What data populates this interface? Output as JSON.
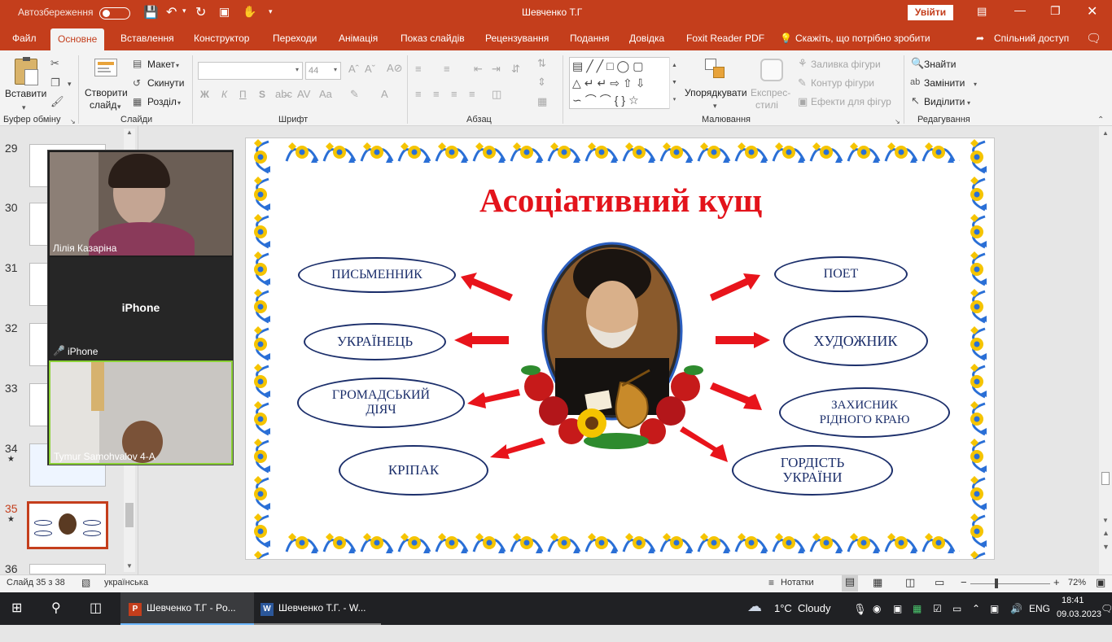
{
  "titlebar": {
    "autosave_label": "Автозбереження",
    "doc_title": "Шевченко Т.Г",
    "signin_button": "Увійти"
  },
  "tabs": [
    "Файл",
    "Основне",
    "Вставлення",
    "Конструктор",
    "Переходи",
    "Анімація",
    "Показ слайдів",
    "Рецензування",
    "Подання",
    "Довідка",
    "Foxit Reader PDF"
  ],
  "active_tab": "Основне",
  "tell_me": "Скажіть, що потрібно зробити",
  "share": "Спільний доступ",
  "ribbon": {
    "paste": "Вставити",
    "new_slide_line1": "Створити",
    "new_slide_line2": "слайд",
    "layout": "Макет",
    "reset": "Скинути",
    "section": "Розділ",
    "font_size": "44",
    "bold": "Ж",
    "italic": "К",
    "underline": "П",
    "strike": "S",
    "arrange": "Упорядкувати",
    "quick_styles_line1": "Експрес-",
    "quick_styles_line2": "стилі",
    "shape_fill": "Заливка фігури",
    "shape_outline": "Контур фігури",
    "shape_effects": "Ефекти для фігур",
    "find": "Знайти",
    "replace": "Замінити",
    "select": "Виділити",
    "groups": {
      "clipboard": "Буфер обміну",
      "slides": "Слайди",
      "font": "Шрифт",
      "paragraph": "Абзац",
      "drawing": "Малювання",
      "editing": "Редагування"
    }
  },
  "slide_numbers": [
    "29",
    "30",
    "31",
    "32",
    "33",
    "34",
    "35",
    "36"
  ],
  "selected_slide": "35",
  "zoom_participants": {
    "p1": "Лілія Казаріна",
    "p2_center": "iPhone",
    "p2_label": "iPhone",
    "p3": "Tymur Samohvalov 4-А"
  },
  "slide": {
    "title": "Асоціативний кущ",
    "ovals": {
      "writer": "ПИСЬМЕННИК",
      "ukrainian": "УКРАЇНЕЦЬ",
      "public_l1": "ГРОМАДСЬКИЙ",
      "public_l2": "ДІЯЧ",
      "serf": "КРІПАК",
      "poet": "ПОЕТ",
      "artist": "ХУДОЖНИК",
      "defender_l1": "ЗАХИСНИК",
      "defender_l2": "РІДНОГО КРАЮ",
      "pride_l1": "ГОРДІСТЬ",
      "pride_l2": "УКРАЇНИ"
    },
    "colors": {
      "title": "#e3131b",
      "oval_border": "#1c2f6b",
      "arrow": "#e8141b",
      "border_blue": "#2a6fd6",
      "border_yellow": "#f5c400"
    }
  },
  "status": {
    "slide_pos": "Слайд 35 з 38",
    "language": "українська",
    "notes": "Нотатки",
    "zoom": "72%"
  },
  "taskbar": {
    "ppt_task": "Шевченко Т.Г - Po...",
    "word_task": "Шевченко Т.Г. - W...",
    "weather_temp": "1°C",
    "weather_text": "Cloudy",
    "lang": "ENG",
    "time": "18:41",
    "date": "09.03.2023"
  }
}
